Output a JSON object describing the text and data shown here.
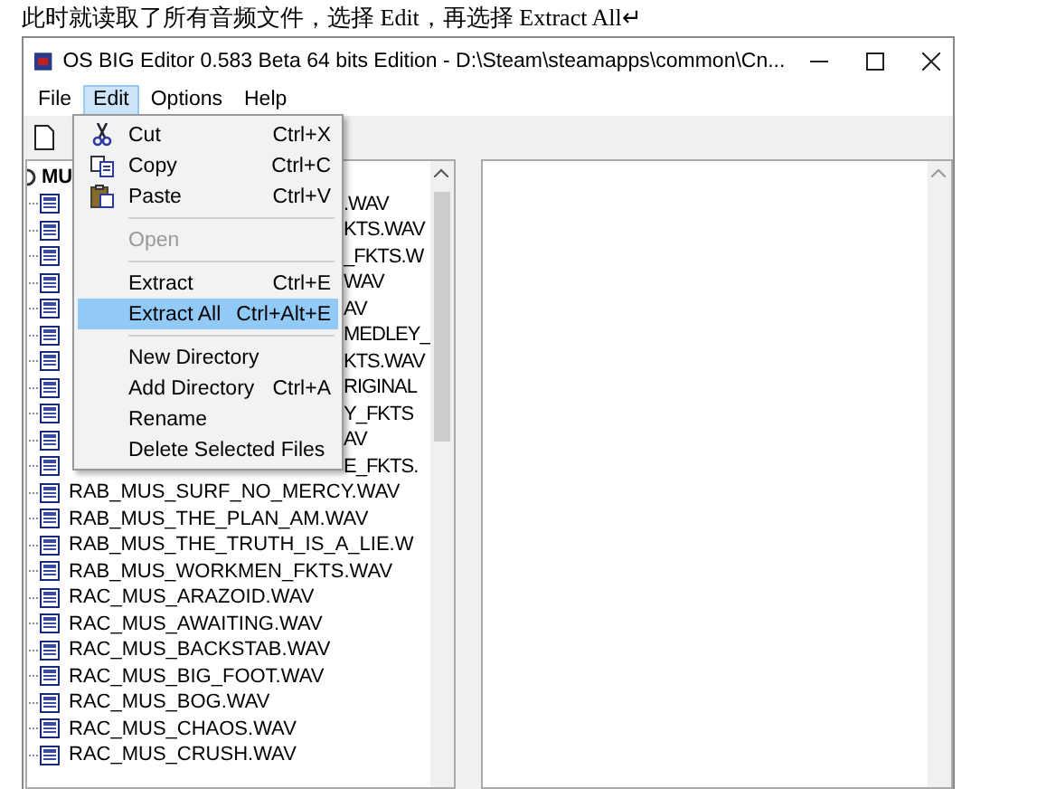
{
  "caption": "此时就读取了所有音频文件，选择 Edit，再选择 Extract All↵",
  "window": {
    "title": "OS BIG Editor 0.583 Beta 64 bits Edition - D:\\Steam\\steamapps\\common\\Cn..."
  },
  "menu_bar": [
    {
      "label": "File",
      "selected": false
    },
    {
      "label": "Edit",
      "selected": true
    },
    {
      "label": "Options",
      "selected": false
    },
    {
      "label": "Help",
      "selected": false
    }
  ],
  "edit_menu": [
    {
      "kind": "item",
      "label": "Cut",
      "shortcut": "Ctrl+X",
      "disabled": false,
      "selected": false
    },
    {
      "kind": "item",
      "label": "Copy",
      "shortcut": "Ctrl+C",
      "disabled": false,
      "selected": false
    },
    {
      "kind": "item",
      "label": "Paste",
      "shortcut": "Ctrl+V",
      "disabled": false,
      "selected": false
    },
    {
      "kind": "separator"
    },
    {
      "kind": "item",
      "label": "Open",
      "disabled": true,
      "selected": false
    },
    {
      "kind": "separator"
    },
    {
      "kind": "item",
      "label": "Extract",
      "shortcut": "Ctrl+E",
      "disabled": false,
      "selected": false
    },
    {
      "kind": "item",
      "label": "Extract All",
      "shortcut": "Ctrl+Alt+E",
      "disabled": false,
      "selected": true
    },
    {
      "kind": "separator"
    },
    {
      "kind": "item",
      "label": "New Directory",
      "disabled": false,
      "selected": false
    },
    {
      "kind": "item",
      "label": "Add Directory",
      "shortcut": "Ctrl+A",
      "disabled": false,
      "selected": false
    },
    {
      "kind": "item",
      "label": "Rename",
      "disabled": false,
      "selected": false
    },
    {
      "kind": "item",
      "label": "Delete Selected Files",
      "disabled": false,
      "selected": false
    }
  ],
  "tree": {
    "root": "MU",
    "files": [
      {
        "kind": "covered",
        "name": ".WAV"
      },
      {
        "kind": "covered",
        "name": "KTS.WAV"
      },
      {
        "kind": "covered",
        "name": "_FKTS.W"
      },
      {
        "kind": "covered",
        "name": "WAV"
      },
      {
        "kind": "covered",
        "name": "AV"
      },
      {
        "kind": "covered",
        "name": "MEDLEY_"
      },
      {
        "kind": "covered",
        "name": "KTS.WAV"
      },
      {
        "kind": "covered",
        "name": "RIGINAL"
      },
      {
        "kind": "covered",
        "name": "Y_FKTS"
      },
      {
        "kind": "covered",
        "name": "AV"
      },
      {
        "kind": "covered",
        "name": "E_FKTS."
      },
      {
        "kind": "file",
        "name": "RAB_MUS_SURF_NO_MERCY.WAV"
      },
      {
        "kind": "file",
        "name": "RAB_MUS_THE_PLAN_AM.WAV"
      },
      {
        "kind": "file",
        "name": "RAB_MUS_THE_TRUTH_IS_A_LIE.W"
      },
      {
        "kind": "file",
        "name": "RAB_MUS_WORKMEN_FKTS.WAV"
      },
      {
        "kind": "file",
        "name": "RAC_MUS_ARAZOID.WAV"
      },
      {
        "kind": "file",
        "name": "RAC_MUS_AWAITING.WAV"
      },
      {
        "kind": "file",
        "name": "RAC_MUS_BACKSTAB.WAV"
      },
      {
        "kind": "file",
        "name": "RAC_MUS_BIG_FOOT.WAV"
      },
      {
        "kind": "file",
        "name": "RAC_MUS_BOG.WAV"
      },
      {
        "kind": "file",
        "name": "RAC_MUS_CHAOS.WAV"
      },
      {
        "kind": "file",
        "name": "RAC_MUS_CRUSH.WAV"
      }
    ]
  }
}
